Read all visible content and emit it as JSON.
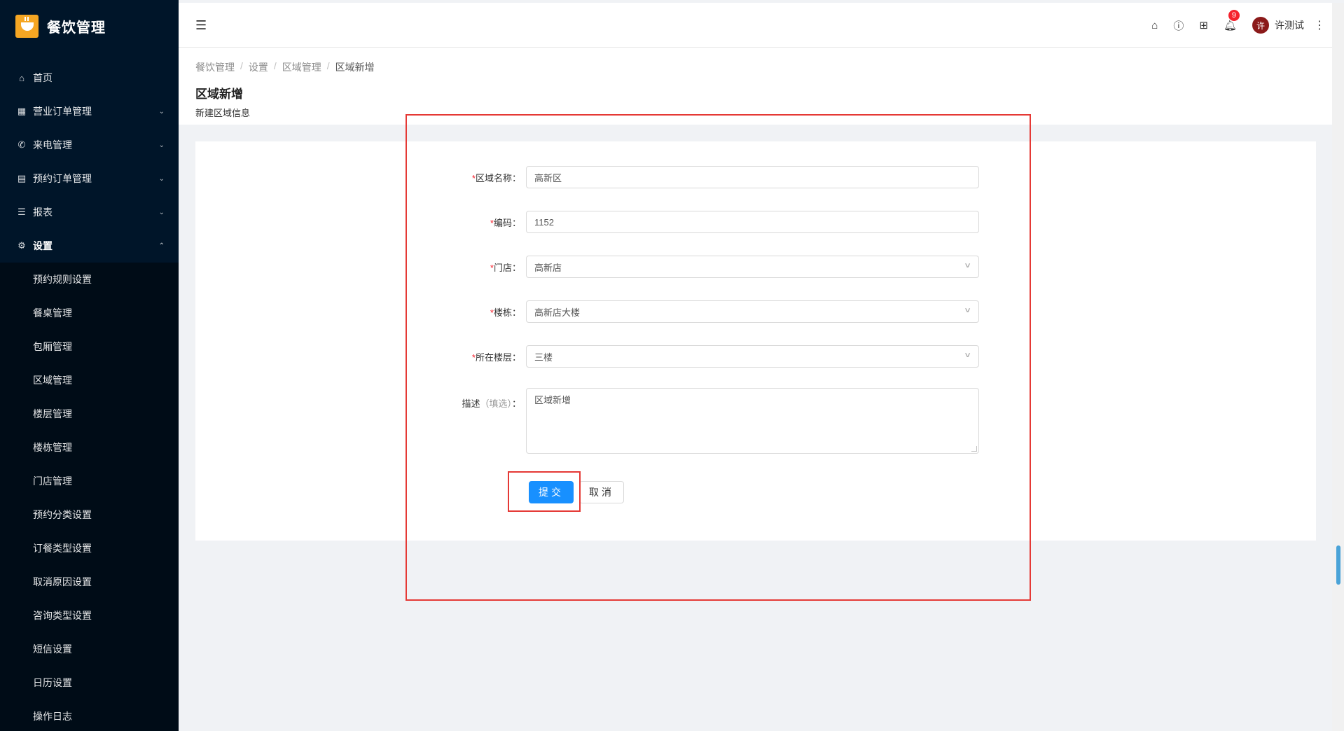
{
  "sidebar": {
    "title": "餐饮管理",
    "menu": [
      {
        "label": "首页",
        "icon": "home-icon",
        "expandable": false
      },
      {
        "label": "营业订单管理",
        "icon": "order-icon",
        "expandable": true
      },
      {
        "label": "来电管理",
        "icon": "phone-icon",
        "expandable": true
      },
      {
        "label": "预约订单管理",
        "icon": "reservation-icon",
        "expandable": true
      },
      {
        "label": "报表",
        "icon": "report-icon",
        "expandable": true
      },
      {
        "label": "设置",
        "icon": "settings-icon",
        "expandable": true,
        "open": true
      }
    ],
    "submenu": [
      "预约规则设置",
      "餐桌管理",
      "包厢管理",
      "区域管理",
      "楼层管理",
      "楼栋管理",
      "门店管理",
      "预约分类设置",
      "订餐类型设置",
      "取消原因设置",
      "咨询类型设置",
      "短信设置",
      "日历设置",
      "操作日志"
    ]
  },
  "header": {
    "notification_count": "9",
    "username": "许测试",
    "avatar_text": "许"
  },
  "breadcrumb": [
    "餐饮管理",
    "设置",
    "区域管理",
    "区域新增"
  ],
  "page": {
    "title": "区域新增",
    "description": "新建区域信息"
  },
  "form": {
    "area_name": {
      "label": "区域名称：",
      "value": "高新区"
    },
    "code": {
      "label": "编码：",
      "value": "1152"
    },
    "store": {
      "label": "门店：",
      "value": "高新店"
    },
    "building": {
      "label": "楼栋：",
      "value": "高新店大楼"
    },
    "floor": {
      "label": "所在楼层：",
      "value": "三楼"
    },
    "description": {
      "label": "描述",
      "optional": "（填选）",
      "colon": "：",
      "value": "区域新增"
    },
    "submit_label": "提交",
    "cancel_label": "取消"
  },
  "colors": {
    "sidebar_bg": "#001529",
    "primary": "#1890ff",
    "annotation": "#e53935",
    "badge": "#f5222d"
  }
}
